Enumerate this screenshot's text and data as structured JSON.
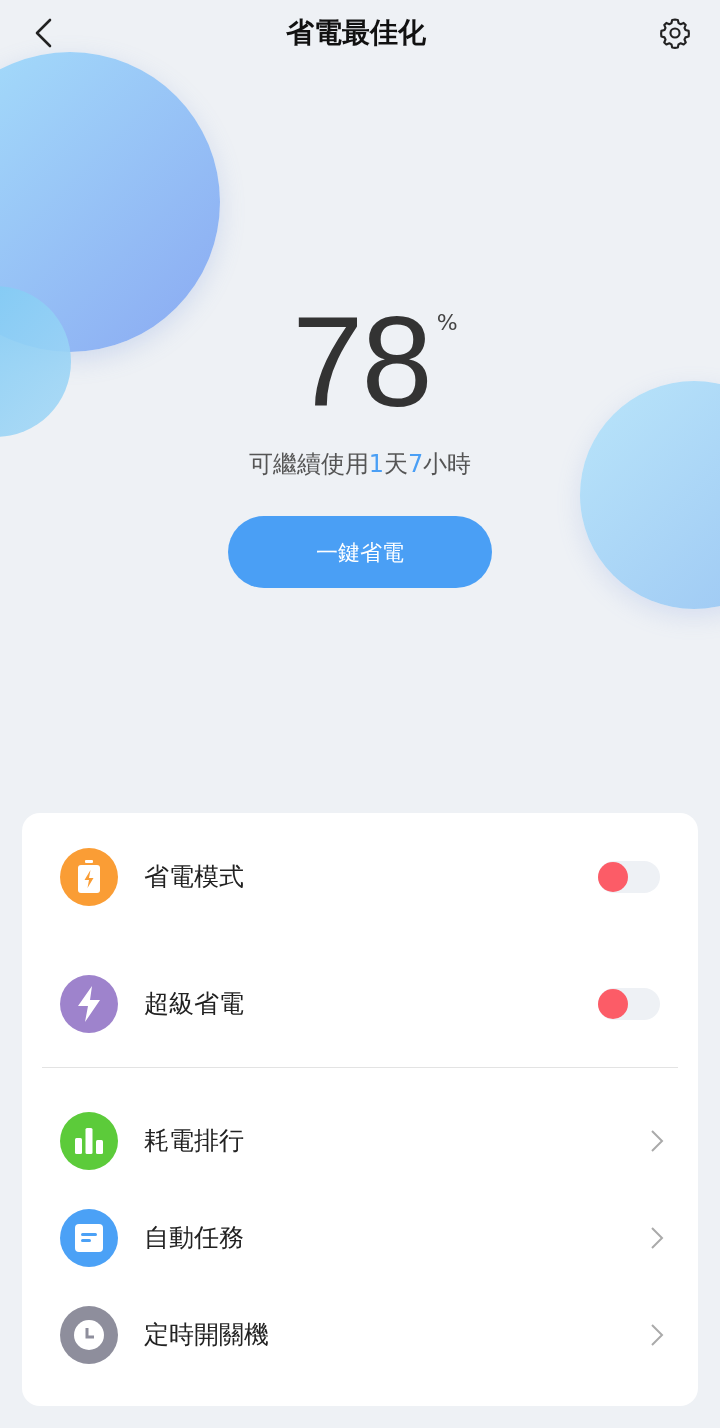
{
  "header": {
    "title": "省電最佳化"
  },
  "battery": {
    "percent": "78",
    "unit": "%",
    "remaining": [
      {
        "text": "可繼續使用",
        "highlight": false
      },
      {
        "text": "1",
        "highlight": true
      },
      {
        "text": "天",
        "highlight": false
      },
      {
        "text": "7",
        "highlight": true
      },
      {
        "text": "小時",
        "highlight": false
      }
    ]
  },
  "action_button": {
    "label": "一鍵省電"
  },
  "groups": [
    {
      "items": [
        {
          "kind": "toggle",
          "color": "#fa9d35",
          "label": "省電模式",
          "on": false
        },
        {
          "kind": "toggle",
          "color": "#9e83cc",
          "label": "超級省電",
          "on": false
        }
      ]
    },
    {
      "items": [
        {
          "kind": "link",
          "color": "#5ccb3a",
          "label": "耗電排行"
        },
        {
          "kind": "link",
          "color": "#4ba1f6",
          "label": "自動任務"
        },
        {
          "kind": "link",
          "color": "#8e8e9c",
          "label": "定時開關機"
        }
      ]
    }
  ]
}
